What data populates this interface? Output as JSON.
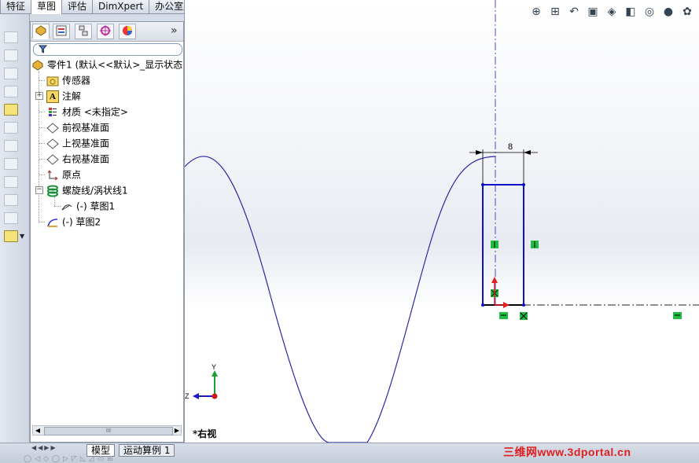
{
  "tabs": [
    "特征",
    "草图",
    "评估",
    "DimXpert",
    "办公室产品"
  ],
  "active_tab": 1,
  "feature_tree": {
    "root": "零件1 (默认<<默认>_显示状态",
    "items": [
      {
        "label": "传感器",
        "icon": "sensor-icon"
      },
      {
        "label": "注解",
        "icon": "annotation-icon"
      },
      {
        "label": "材质 <未指定>",
        "icon": "material-icon"
      },
      {
        "label": "前视基准面",
        "icon": "plane-icon"
      },
      {
        "label": "上视基准面",
        "icon": "plane-icon"
      },
      {
        "label": "右视基准面",
        "icon": "plane-icon"
      },
      {
        "label": "原点",
        "icon": "origin-icon"
      },
      {
        "label": "螺旋线/涡状线1",
        "icon": "helix-icon"
      },
      {
        "label": "(-) 草图1",
        "icon": "sketch-icon"
      },
      {
        "label": "(-) 草图2",
        "icon": "sketch-icon"
      }
    ],
    "expand_more": "»",
    "scroll_thumb": "III"
  },
  "bottom_tabs": [
    "模型",
    "运动算例 1"
  ],
  "view_label": "*右视",
  "dimension": "8",
  "triad": {
    "y": "Y",
    "z": "Z"
  },
  "watermark": "三维网www.3dportal.cn",
  "colors": {
    "sketch": "#1010c8",
    "helix": "#3030a8",
    "relation": "#22bb44",
    "origin": "#e02020"
  }
}
